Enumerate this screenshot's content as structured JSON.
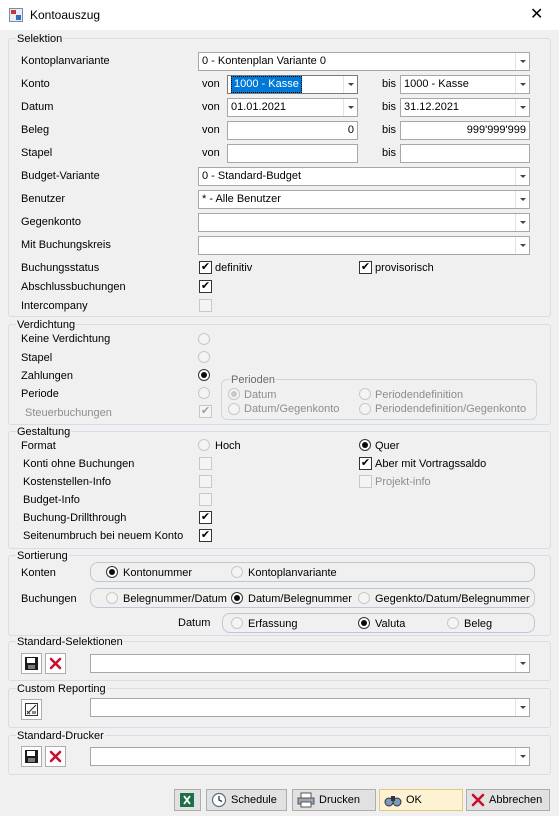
{
  "window": {
    "title": "Kontoauszug",
    "icon": "app-icon"
  },
  "selektion": {
    "title": "Selektion",
    "kontoplanvariante": {
      "label": "Kontoplanvariante",
      "value": "0 - Kontenplan Variante 0"
    },
    "konto": {
      "label": "Konto",
      "von_label": "von",
      "von_value": "1000 - Kasse",
      "bis_label": "bis",
      "bis_value": "1000 - Kasse"
    },
    "datum": {
      "label": "Datum",
      "von_label": "von",
      "von_value": "01.01.2021",
      "bis_label": "bis",
      "bis_value": "31.12.2021"
    },
    "beleg": {
      "label": "Beleg",
      "von_label": "von",
      "von_value": "0",
      "bis_label": "bis",
      "bis_value": "999'999'999"
    },
    "stapel": {
      "label": "Stapel",
      "von_label": "von",
      "von_value": "",
      "bis_label": "bis",
      "bis_value": ""
    },
    "budget_variante": {
      "label": "Budget-Variante",
      "value": "0 - Standard-Budget"
    },
    "benutzer": {
      "label": "Benutzer",
      "value": "* - Alle Benutzer"
    },
    "gegenkonto": {
      "label": "Gegenkonto",
      "value": ""
    },
    "buchungskreis": {
      "label": "Mit Buchungskreis",
      "value": ""
    },
    "buchungsstatus": {
      "label": "Buchungsstatus",
      "definitiv": "definitiv",
      "provisorisch": "provisorisch"
    },
    "abschlussbuchungen": {
      "label": "Abschlussbuchungen"
    },
    "intercompany": {
      "label": "Intercompany"
    }
  },
  "verdichtung": {
    "title": "Verdichtung",
    "keine": "Keine Verdichtung",
    "stapel": "Stapel",
    "zahlungen": "Zahlungen",
    "periode": "Periode",
    "steuerbuchungen": "Steuerbuchungen",
    "perioden": {
      "title": "Perioden",
      "datum": "Datum",
      "datum_gegenkonto": "Datum/Gegenkonto",
      "periodendefinition": "Periodendefinition",
      "periodendefinition_gegenkonto": "Periodendefinition/Gegenkonto"
    }
  },
  "gestaltung": {
    "title": "Gestaltung",
    "format": "Format",
    "hoch": "Hoch",
    "quer": "Quer",
    "konti_ohne": "Konti ohne Buchungen",
    "vortragssaldo": "Aber mit Vortragssaldo",
    "kostenstellen": "Kostenstellen-Info",
    "projekt": "Projekt-info",
    "budget_info": "Budget-Info",
    "drillthrough": "Buchung-Drillthrough",
    "seitenumbruch": "Seitenumbruch bei neuem Konto"
  },
  "sortierung": {
    "title": "Sortierung",
    "konten": {
      "label": "Konten",
      "opt1": "Kontonummer",
      "opt2": "Kontoplanvariante"
    },
    "buchungen": {
      "label": "Buchungen",
      "opt1": "Belegnummer/Datum",
      "opt2": "Datum/Belegnummer",
      "opt3": "Gegenkto/Datum/Belegnummer"
    },
    "datum": {
      "label": "Datum",
      "opt1": "Erfassung",
      "opt2": "Valuta",
      "opt3": "Beleg"
    }
  },
  "standard_selektionen": {
    "title": "Standard-Selektionen",
    "value": ""
  },
  "custom_reporting": {
    "title": "Custom Reporting",
    "value": ""
  },
  "standard_drucker": {
    "title": "Standard-Drucker",
    "value": ""
  },
  "buttons": {
    "schedule": "Schedule",
    "drucken": "Drucken",
    "ok": "OK",
    "abbrechen": "Abbrechen"
  },
  "colors": {
    "accent": "#0078d7",
    "ok_bg": "#fdf2d2",
    "delete_red": "#c8102e",
    "group_border": "#d6dde8"
  }
}
